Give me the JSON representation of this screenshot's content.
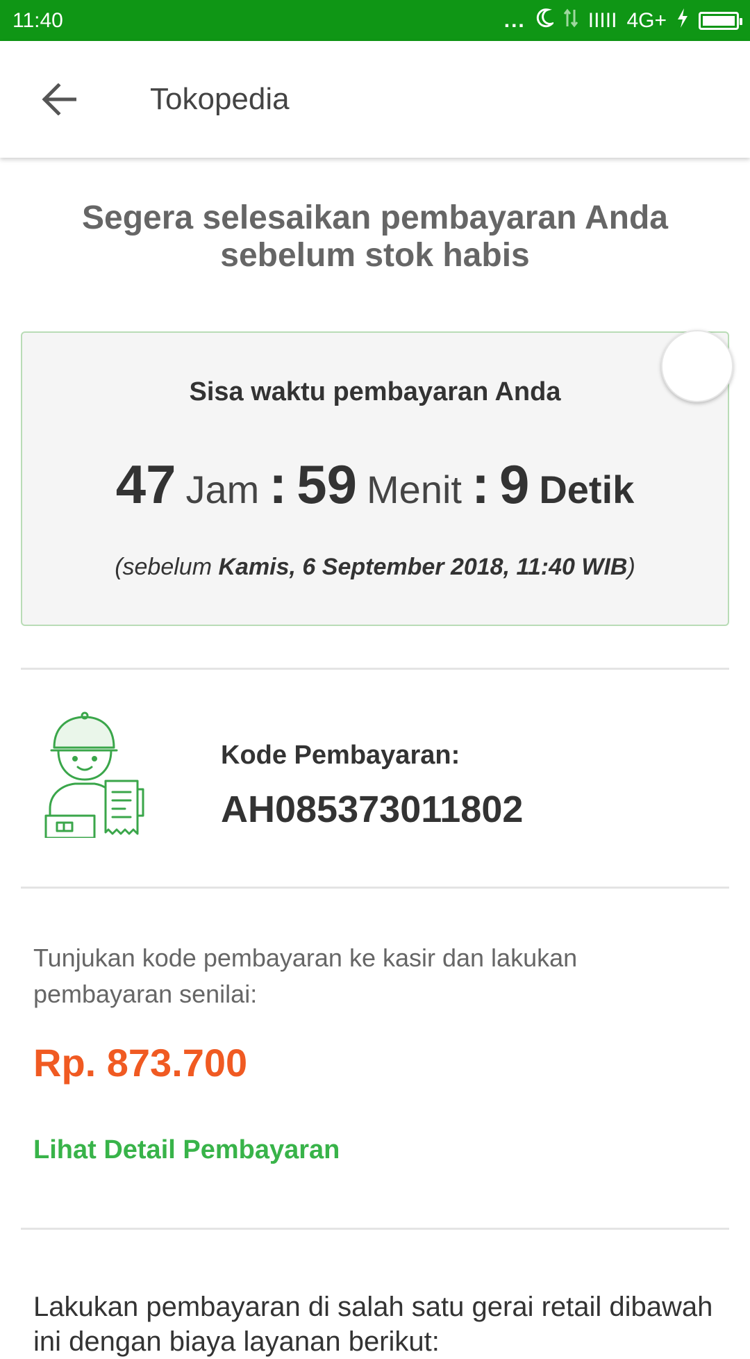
{
  "status_bar": {
    "time": "11:40",
    "dots": "...",
    "signal": "IIIII",
    "network": "4G+"
  },
  "app_bar": {
    "title": "Tokopedia"
  },
  "headline": "Segera selesaikan pembayaran Anda sebelum stok habis",
  "timer": {
    "label": "Sisa waktu pembayaran Anda",
    "hours": "47",
    "hours_unit": "Jam",
    "sep1": ":",
    "minutes": "59",
    "minutes_unit": "Menit",
    "sep2": ":",
    "seconds": "9",
    "seconds_unit": "Detik",
    "deadline_prefix": "(sebelum ",
    "deadline_value": "Kamis, 6 September 2018, 11:40 WIB",
    "deadline_suffix": ")"
  },
  "payment_code": {
    "label": "Kode Pembayaran:",
    "value": "AH085373011802"
  },
  "instruction": "Tunjukan kode pembayaran ke kasir dan lakukan pembayaran senilai:",
  "amount": "Rp. 873.700",
  "detail_link": "Lihat Detail Pembayaran",
  "retail_text": "Lakukan pembayaran di salah satu gerai retail dibawah ini dengan biaya layanan berikut:",
  "colors": {
    "status_bar": "#0f9615",
    "accent_green": "#38b349",
    "amount_orange": "#f05a22"
  }
}
